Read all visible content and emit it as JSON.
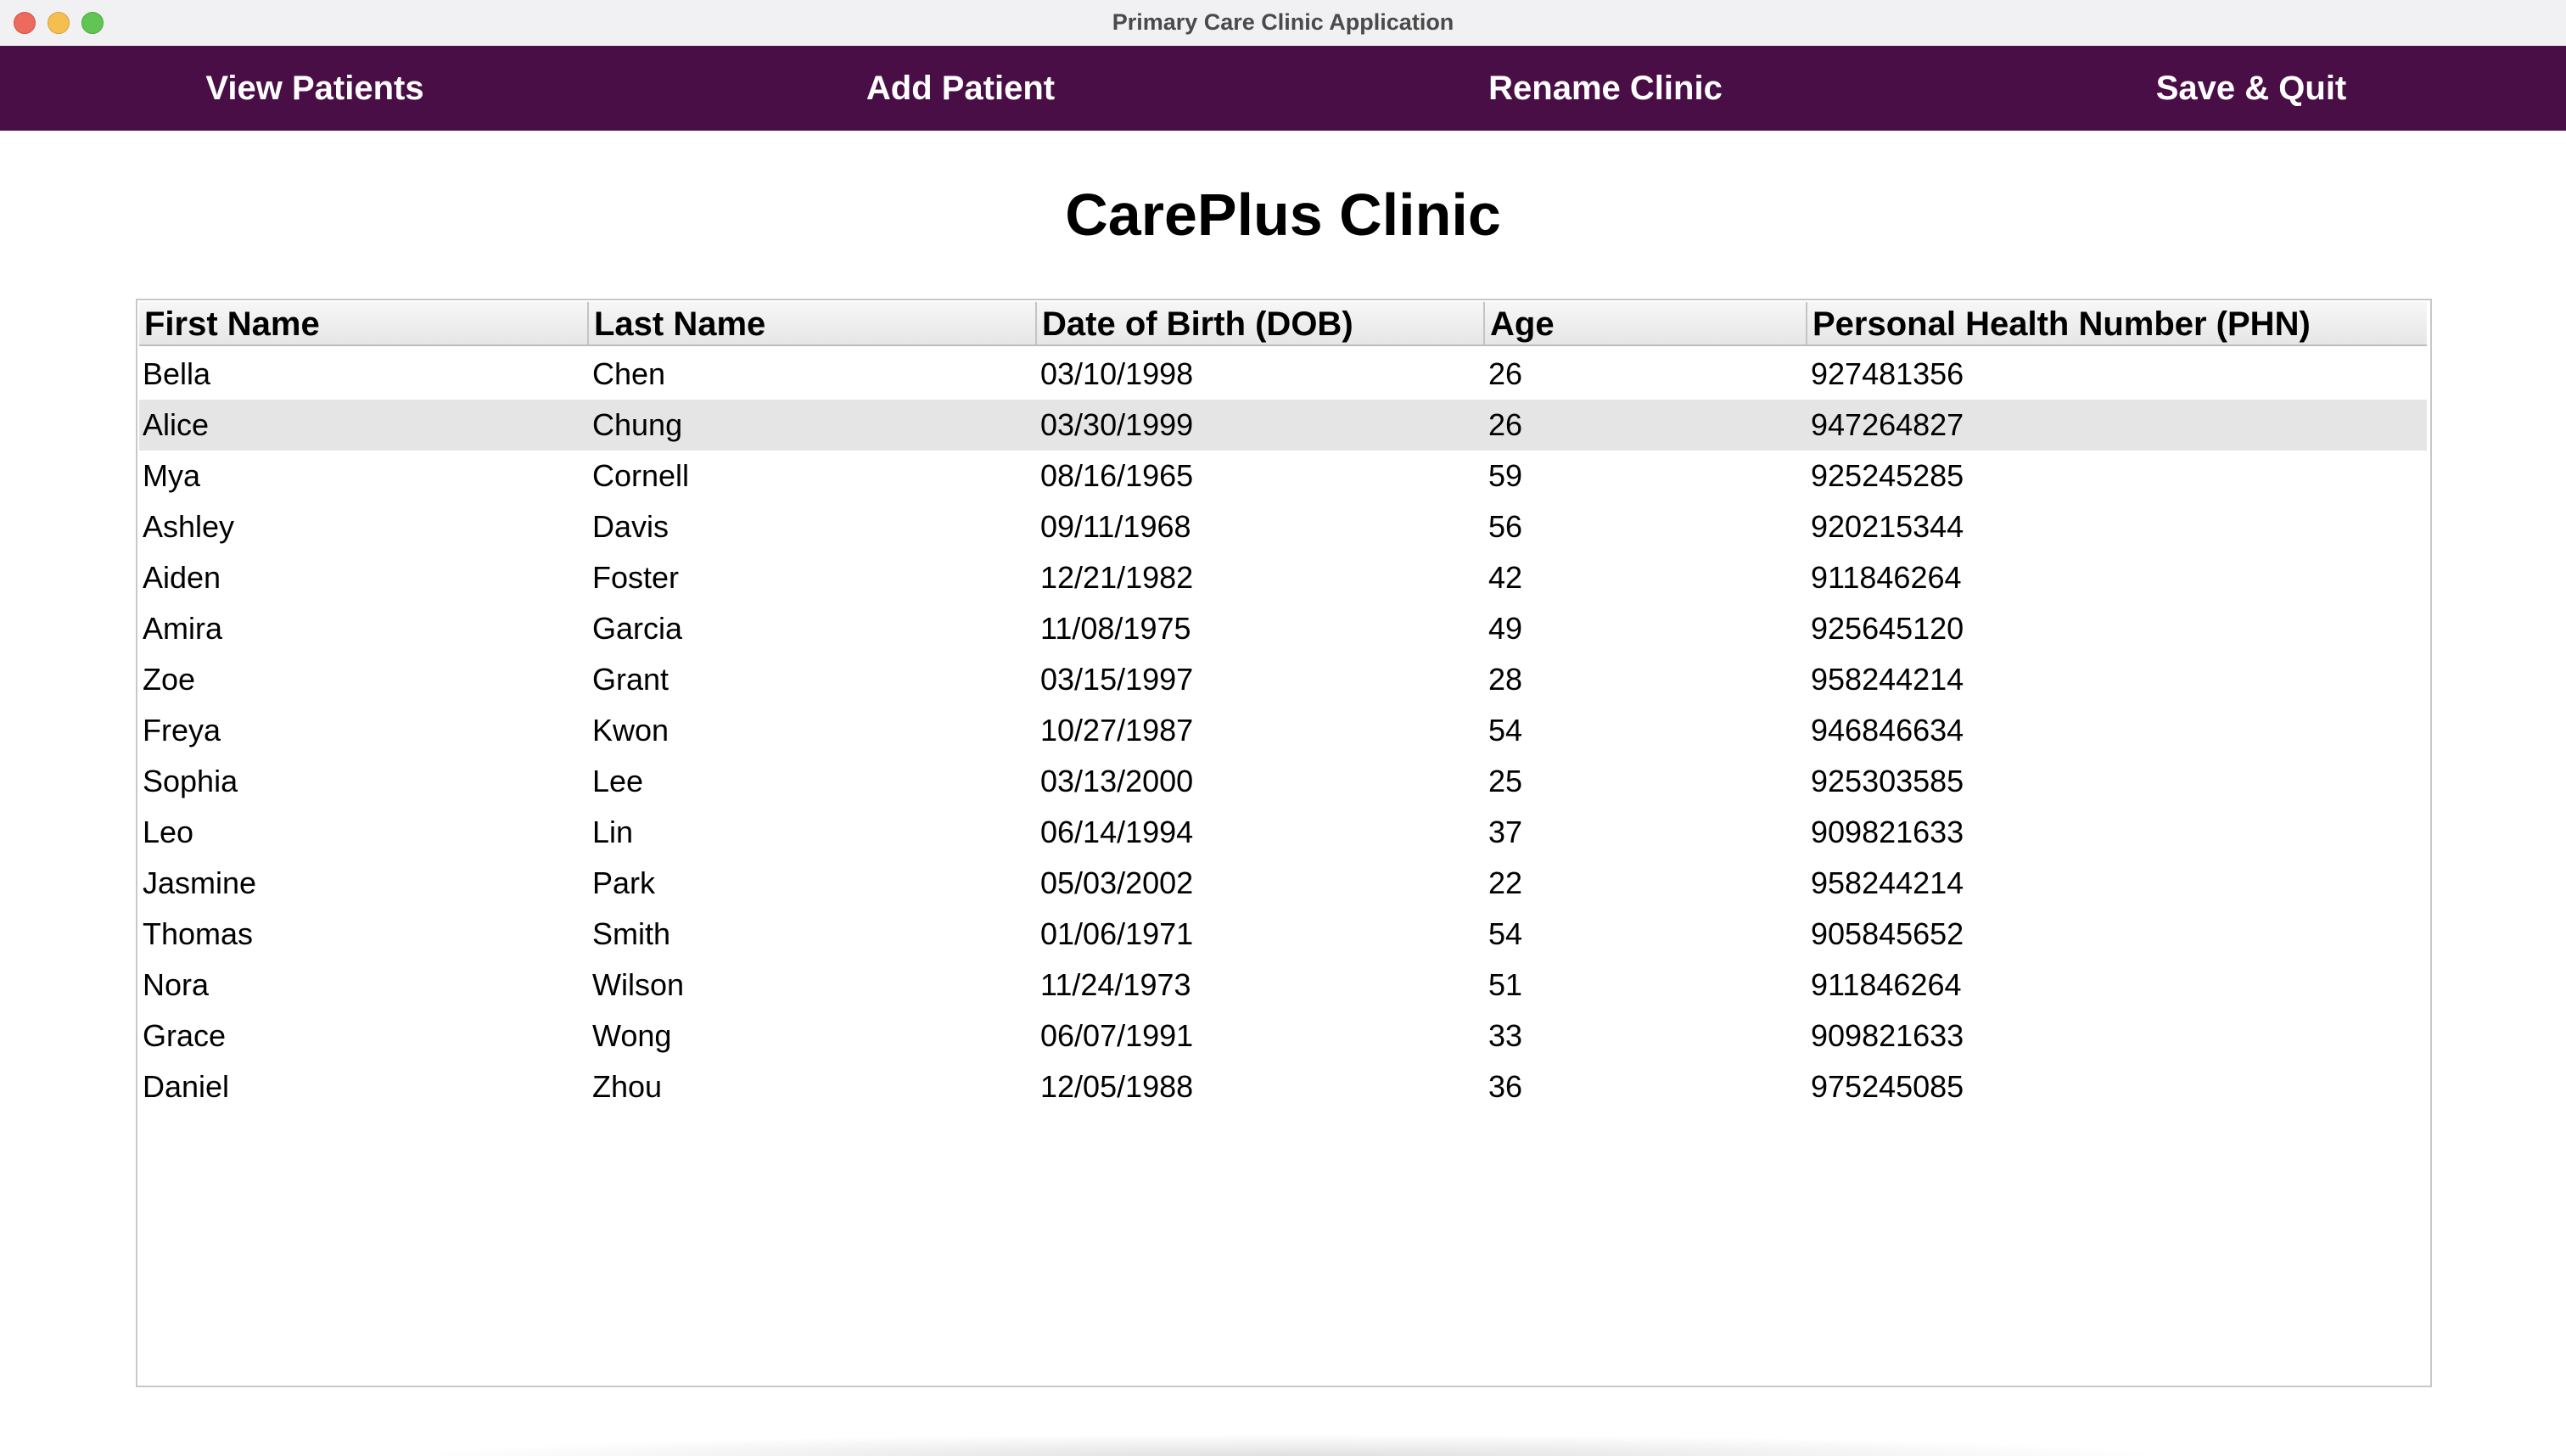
{
  "window": {
    "title": "Primary Care Clinic Application"
  },
  "nav": {
    "view_patients": "View Patients",
    "add_patient": "Add Patient",
    "rename_clinic": "Rename Clinic",
    "save_quit": "Save & Quit"
  },
  "clinic": {
    "name": "CarePlus Clinic"
  },
  "table": {
    "columns": [
      "First Name",
      "Last Name",
      "Date of Birth (DOB)",
      "Age",
      "Personal Health Number (PHN)"
    ],
    "selected_row_index": 1,
    "rows": [
      {
        "first": "Bella",
        "last": "Chen",
        "dob": "03/10/1998",
        "age": "26",
        "phn": "927481356"
      },
      {
        "first": "Alice",
        "last": "Chung",
        "dob": "03/30/1999",
        "age": "26",
        "phn": "947264827"
      },
      {
        "first": "Mya",
        "last": "Cornell",
        "dob": "08/16/1965",
        "age": "59",
        "phn": "925245285"
      },
      {
        "first": "Ashley",
        "last": "Davis",
        "dob": "09/11/1968",
        "age": "56",
        "phn": "920215344"
      },
      {
        "first": "Aiden",
        "last": "Foster",
        "dob": "12/21/1982",
        "age": "42",
        "phn": "911846264"
      },
      {
        "first": "Amira",
        "last": "Garcia",
        "dob": "11/08/1975",
        "age": "49",
        "phn": "925645120"
      },
      {
        "first": "Zoe",
        "last": "Grant",
        "dob": "03/15/1997",
        "age": "28",
        "phn": "958244214"
      },
      {
        "first": "Freya",
        "last": "Kwon",
        "dob": "10/27/1987",
        "age": "54",
        "phn": "946846634"
      },
      {
        "first": "Sophia",
        "last": "Lee",
        "dob": "03/13/2000",
        "age": "25",
        "phn": "925303585"
      },
      {
        "first": "Leo",
        "last": "Lin",
        "dob": "06/14/1994",
        "age": "37",
        "phn": "909821633"
      },
      {
        "first": "Jasmine",
        "last": "Park",
        "dob": "05/03/2002",
        "age": "22",
        "phn": "958244214"
      },
      {
        "first": "Thomas",
        "last": "Smith",
        "dob": "01/06/1971",
        "age": "54",
        "phn": "905845652"
      },
      {
        "first": "Nora",
        "last": "Wilson",
        "dob": "11/24/1973",
        "age": "51",
        "phn": "911846264"
      },
      {
        "first": "Grace",
        "last": "Wong",
        "dob": "06/07/1991",
        "age": "33",
        "phn": "909821633"
      },
      {
        "first": "Daniel",
        "last": "Zhou",
        "dob": "12/05/1988",
        "age": "36",
        "phn": "975245085"
      }
    ]
  },
  "colors": {
    "navbar": "#4a0e47",
    "selected_row": "#e5e5e5"
  }
}
